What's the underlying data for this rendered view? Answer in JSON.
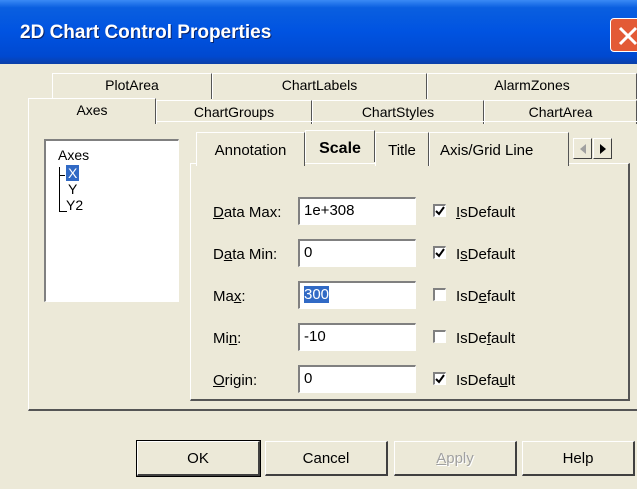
{
  "window": {
    "title": "2D Chart Control Properties"
  },
  "tabs_row_back": [
    {
      "label": "PlotArea"
    },
    {
      "label": "ChartLabels"
    },
    {
      "label": "AlarmZones"
    }
  ],
  "tabs_row_front": [
    {
      "label": "Axes"
    },
    {
      "label": "ChartGroups"
    },
    {
      "label": "ChartStyles"
    },
    {
      "label": "ChartArea"
    }
  ],
  "tree": {
    "root": "Axes",
    "items": [
      {
        "label": "X",
        "selected": true
      },
      {
        "label": "Y"
      },
      {
        "label": "Y2"
      }
    ]
  },
  "inner_tabs": [
    {
      "label": "Annotation"
    },
    {
      "label": "Scale",
      "active": true
    },
    {
      "label": "Title"
    },
    {
      "label": "Axis/Grid Line"
    }
  ],
  "fields": [
    {
      "label_pre": "",
      "label_ul": "D",
      "label_post": "ata Max:",
      "value": "1e+308",
      "checked": true,
      "check_pre": "",
      "check_ul": "I",
      "check_post": "sDefault"
    },
    {
      "label_pre": "D",
      "label_ul": "a",
      "label_post": "ta Min:",
      "value": "0",
      "checked": true,
      "check_pre": "I",
      "check_ul": "s",
      "check_post": "Default"
    },
    {
      "label_pre": "Ma",
      "label_ul": "x",
      "label_post": ":",
      "value": "300",
      "checked": false,
      "check_pre": "IsD",
      "check_ul": "e",
      "check_post": "fault"
    },
    {
      "label_pre": "Mi",
      "label_ul": "n",
      "label_post": ":",
      "value": "-10",
      "checked": false,
      "check_pre": "IsDe",
      "check_ul": "f",
      "check_post": "ault"
    },
    {
      "label_pre": "",
      "label_ul": "O",
      "label_post": "rigin:",
      "value": "0",
      "checked": true,
      "check_pre": "IsDefa",
      "check_ul": "u",
      "check_post": "lt"
    }
  ],
  "buttons": {
    "ok": "OK",
    "cancel": "Cancel",
    "apply_ul": "A",
    "apply_rest": "pply",
    "help": "Help"
  },
  "colors": {
    "titlebar": "#0053e1",
    "close": "#e35a36",
    "face": "#ece9d8",
    "selection": "#316ac5"
  }
}
